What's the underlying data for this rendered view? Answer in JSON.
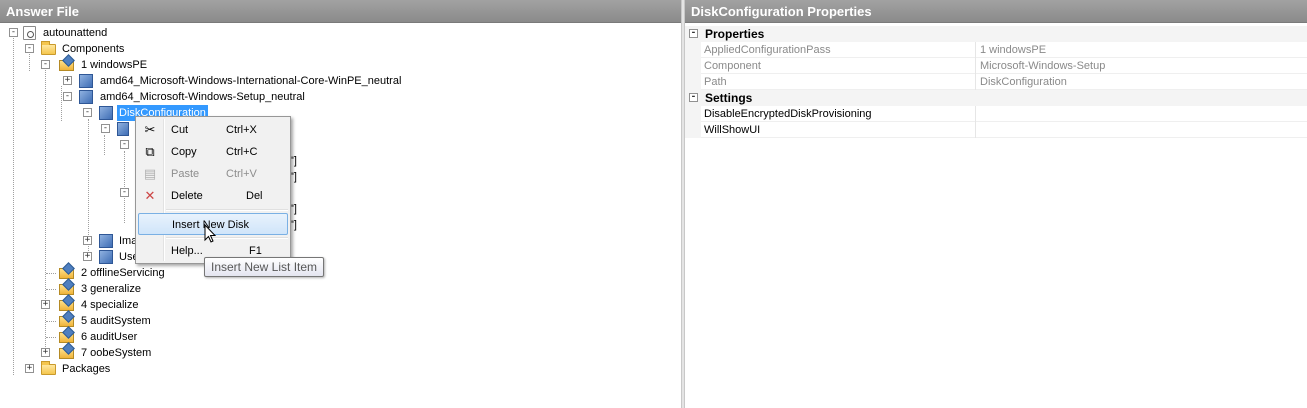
{
  "answer_file": {
    "header": "Answer File",
    "tree": [
      {
        "id": "autounattend",
        "label": "autounattend",
        "expander": "-",
        "icon": "document-icon"
      },
      {
        "id": "components",
        "label": "Components",
        "expander": "-",
        "icon": "folder-icon"
      },
      {
        "id": "windowspe",
        "label": "1 windowsPE",
        "expander": "-",
        "icon": "config-pass-icon"
      },
      {
        "id": "international",
        "label": "amd64_Microsoft-Windows-International-Core-WinPE_neutral",
        "expander": "+",
        "icon": "component-icon"
      },
      {
        "id": "setup",
        "label": "amd64_Microsoft-Windows-Setup_neutral",
        "expander": "-",
        "icon": "component-icon"
      },
      {
        "id": "diskconfig",
        "label": "DiskConfiguration",
        "expander": "-",
        "icon": "component-icon",
        "selected": true
      },
      {
        "id": "img",
        "label": "Ima",
        "expander": "+",
        "icon": "component-icon"
      },
      {
        "id": "user",
        "label": "Use",
        "expander": "+",
        "icon": "component-icon"
      },
      {
        "id": "offline",
        "label": "2 offlineServicing",
        "expander": "",
        "icon": "config-pass-icon"
      },
      {
        "id": "generalize",
        "label": "3 generalize",
        "expander": "",
        "icon": "config-pass-icon"
      },
      {
        "id": "specialize",
        "label": "4 specialize",
        "expander": "+",
        "icon": "config-pass-icon"
      },
      {
        "id": "auditsystem",
        "label": "5 auditSystem",
        "expander": "",
        "icon": "config-pass-icon"
      },
      {
        "id": "audituser",
        "label": "6 auditUser",
        "expander": "",
        "icon": "config-pass-icon"
      },
      {
        "id": "oobesystem",
        "label": "7 oobeSystem",
        "expander": "+",
        "icon": "config-pass-icon"
      },
      {
        "id": "packages",
        "label": "Packages",
        "expander": "+",
        "icon": "folder-icon"
      }
    ],
    "hidden_fragments": [
      "\"]",
      "\"]",
      "\"]",
      "\"]"
    ]
  },
  "context_menu": {
    "items": [
      {
        "label": "Cut",
        "shortcut": "Ctrl+X",
        "icon": "scissors-icon",
        "disabled": false
      },
      {
        "label": "Copy",
        "shortcut": "Ctrl+C",
        "icon": "copy-icon",
        "disabled": false
      },
      {
        "label": "Paste",
        "shortcut": "Ctrl+V",
        "icon": "paste-icon",
        "disabled": true
      },
      {
        "label": "Delete",
        "shortcut": "Del",
        "icon": "delete-icon",
        "disabled": false
      },
      {
        "label": "Insert New Disk",
        "shortcut": "",
        "icon": "",
        "disabled": false,
        "highlighted": true
      },
      {
        "label": "Help...",
        "shortcut": "F1",
        "icon": "",
        "disabled": false
      }
    ],
    "tooltip": "Insert New List Item"
  },
  "properties": {
    "header": "DiskConfiguration Properties",
    "categories": [
      {
        "label": "Properties",
        "expander": "-",
        "rows": [
          {
            "name": "AppliedConfigurationPass",
            "value": "1 windowsPE",
            "readonly": true
          },
          {
            "name": "Component",
            "value": "Microsoft-Windows-Setup",
            "readonly": true
          },
          {
            "name": "Path",
            "value": "DiskConfiguration",
            "readonly": true
          }
        ]
      },
      {
        "label": "Settings",
        "expander": "-",
        "rows": [
          {
            "name": "DisableEncryptedDiskProvisioning",
            "value": "",
            "readonly": false
          },
          {
            "name": "WillShowUI",
            "value": "",
            "readonly": false
          }
        ]
      }
    ]
  },
  "colors": {
    "header_gray": "#949494",
    "selection_blue": "#3399ff",
    "menu_highlight_border": "#7ab0e4"
  }
}
